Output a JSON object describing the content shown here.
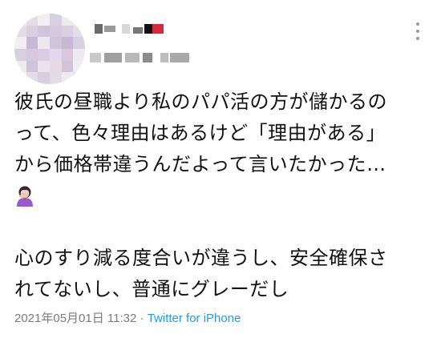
{
  "tweet": {
    "lines": [
      "彼氏の昼職より私のパパ活の方が儲かるの",
      "って、色々理由はあるけど「理由がある」",
      "から価格帯違うんだよって言いたかった…",
      "",
      "",
      "心のすり減る度合いが違うし、安全確保さ",
      "れてないし、普通にグレーだし"
    ],
    "emoji": "facepalm-woman-emoji",
    "timestamp": "2021年05月01日 11:32",
    "separator": " · ",
    "source": "Twitter for iPhone"
  },
  "colors": {
    "text": "#111111",
    "meta": "#7b7b7b",
    "link": "#1d9bf0",
    "menu_dots": "#999999"
  }
}
